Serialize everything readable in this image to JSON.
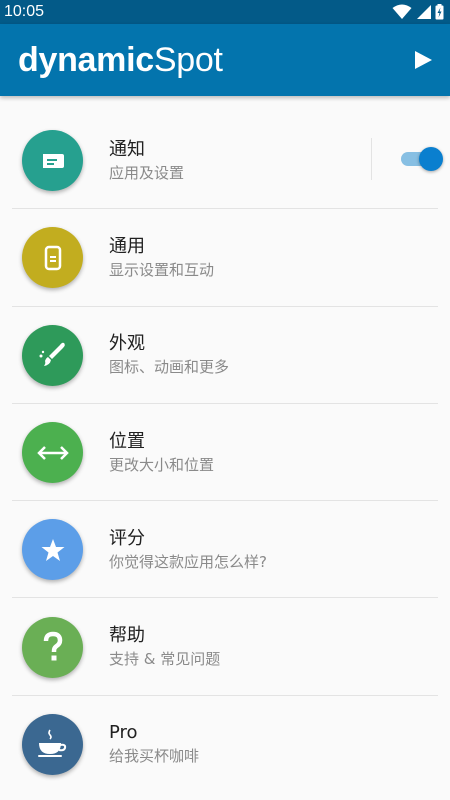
{
  "status_bar": {
    "time": "10:05"
  },
  "app_bar": {
    "title_bold": "dynamic",
    "title_light": "Spot"
  },
  "colors": {
    "status_bar": "#035a88",
    "app_bar": "#0374ad",
    "notification": "#26a08f",
    "general": "#c2ad1f",
    "appearance": "#2e9a5a",
    "position": "#4cb04f",
    "rate": "#5c9ee8",
    "help": "#6aaf55",
    "pro": "#3b6891"
  },
  "items": [
    {
      "title": "通知",
      "subtitle": "应用及设置",
      "icon": "message-icon",
      "toggle_on": true
    },
    {
      "title": "通用",
      "subtitle": "显示设置和互动",
      "icon": "phone-icon"
    },
    {
      "title": "外观",
      "subtitle": "图标、动画和更多",
      "icon": "brush-icon"
    },
    {
      "title": "位置",
      "subtitle": "更改大小和位置",
      "icon": "arrows-horizontal-icon"
    },
    {
      "title": "评分",
      "subtitle": "你觉得这款应用怎么样?",
      "icon": "star-icon"
    },
    {
      "title": "帮助",
      "subtitle": "支持 & 常见问题",
      "icon": "question-icon"
    },
    {
      "title": "Pro",
      "subtitle": "给我买杯咖啡",
      "icon": "coffee-icon"
    }
  ]
}
